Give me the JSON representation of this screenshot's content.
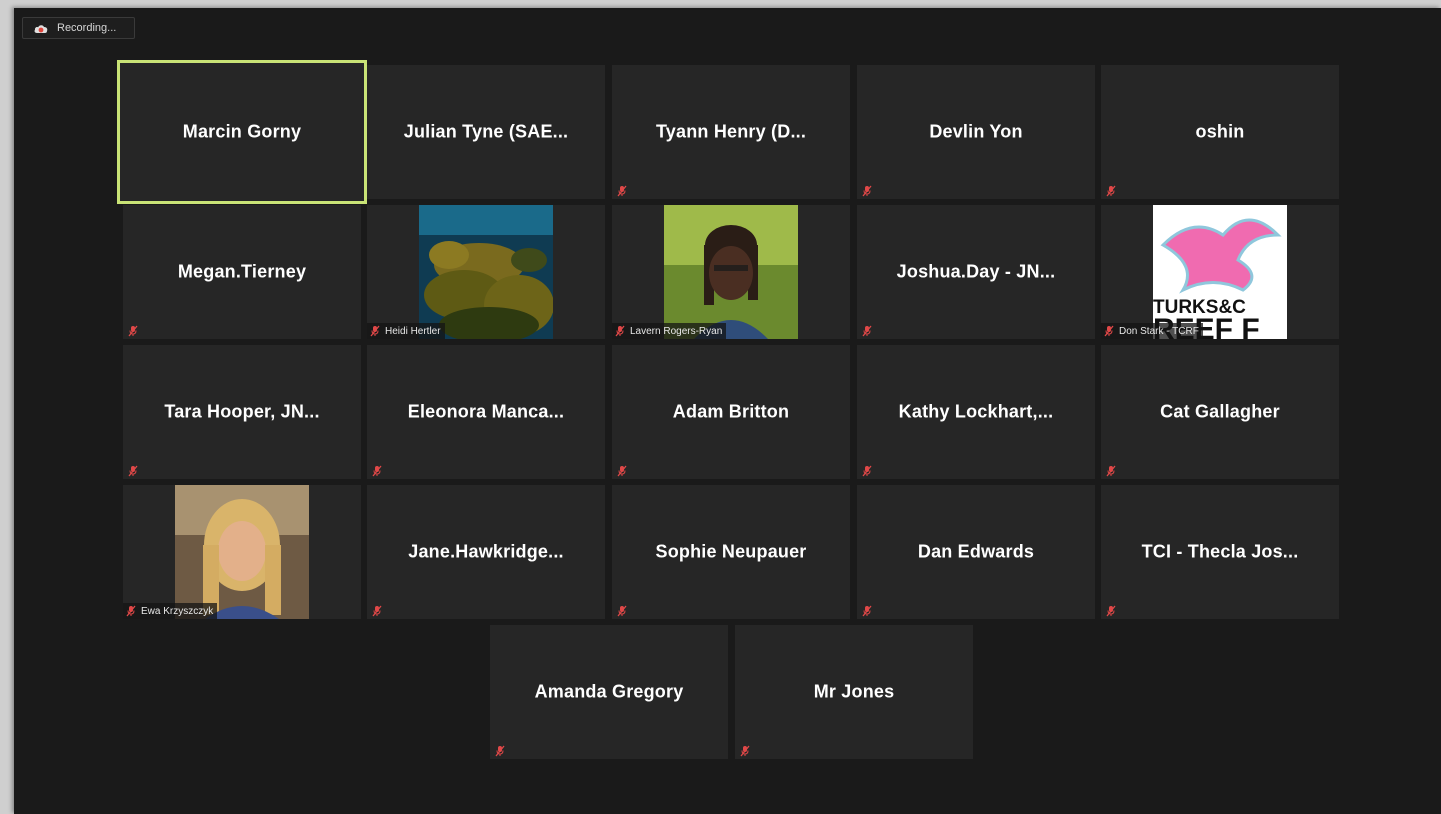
{
  "recording": {
    "label": "Recording..."
  },
  "colors": {
    "active_speaker": "#c9e376",
    "muted": "#e04848",
    "tile_bg": "#262626"
  },
  "participants": [
    {
      "name": "Marcin Gorny",
      "muted": false,
      "active": true
    },
    {
      "name": "Julian Tyne (SAE...",
      "muted": false
    },
    {
      "name": "Tyann Henry (D...",
      "muted": true
    },
    {
      "name": "Devlin Yon",
      "muted": true
    },
    {
      "name": "oshin",
      "muted": true
    },
    {
      "name": "Megan.Tierney",
      "muted": true
    },
    {
      "name": "Heidi Hertler",
      "muted": true,
      "video": "coral-reef"
    },
    {
      "name": "Lavern Rogers-Ryan",
      "muted": true,
      "video": "woman-portrait"
    },
    {
      "name": "Joshua.Day - JN...",
      "muted": true
    },
    {
      "name": "Don Stark - TCRF",
      "muted": true,
      "video": "logo",
      "logo_text": [
        "TURKS&C",
        "REEF F"
      ]
    },
    {
      "name": "Tara Hooper, JN...",
      "muted": true
    },
    {
      "name": "Eleonora Manca...",
      "muted": true
    },
    {
      "name": "Adam Britton",
      "muted": true
    },
    {
      "name": "Kathy Lockhart,...",
      "muted": true
    },
    {
      "name": "Cat Gallagher",
      "muted": true
    },
    {
      "name": "Ewa Krzyszczyk",
      "muted": true,
      "video": "blonde-portrait"
    },
    {
      "name": "Jane.Hawkridge...",
      "muted": true
    },
    {
      "name": "Sophie Neupauer",
      "muted": true
    },
    {
      "name": "Dan Edwards",
      "muted": true
    },
    {
      "name": "TCI - Thecla Jos...",
      "muted": true
    },
    {
      "name": "Amanda Gregory",
      "muted": true
    },
    {
      "name": "Mr Jones",
      "muted": true
    }
  ]
}
